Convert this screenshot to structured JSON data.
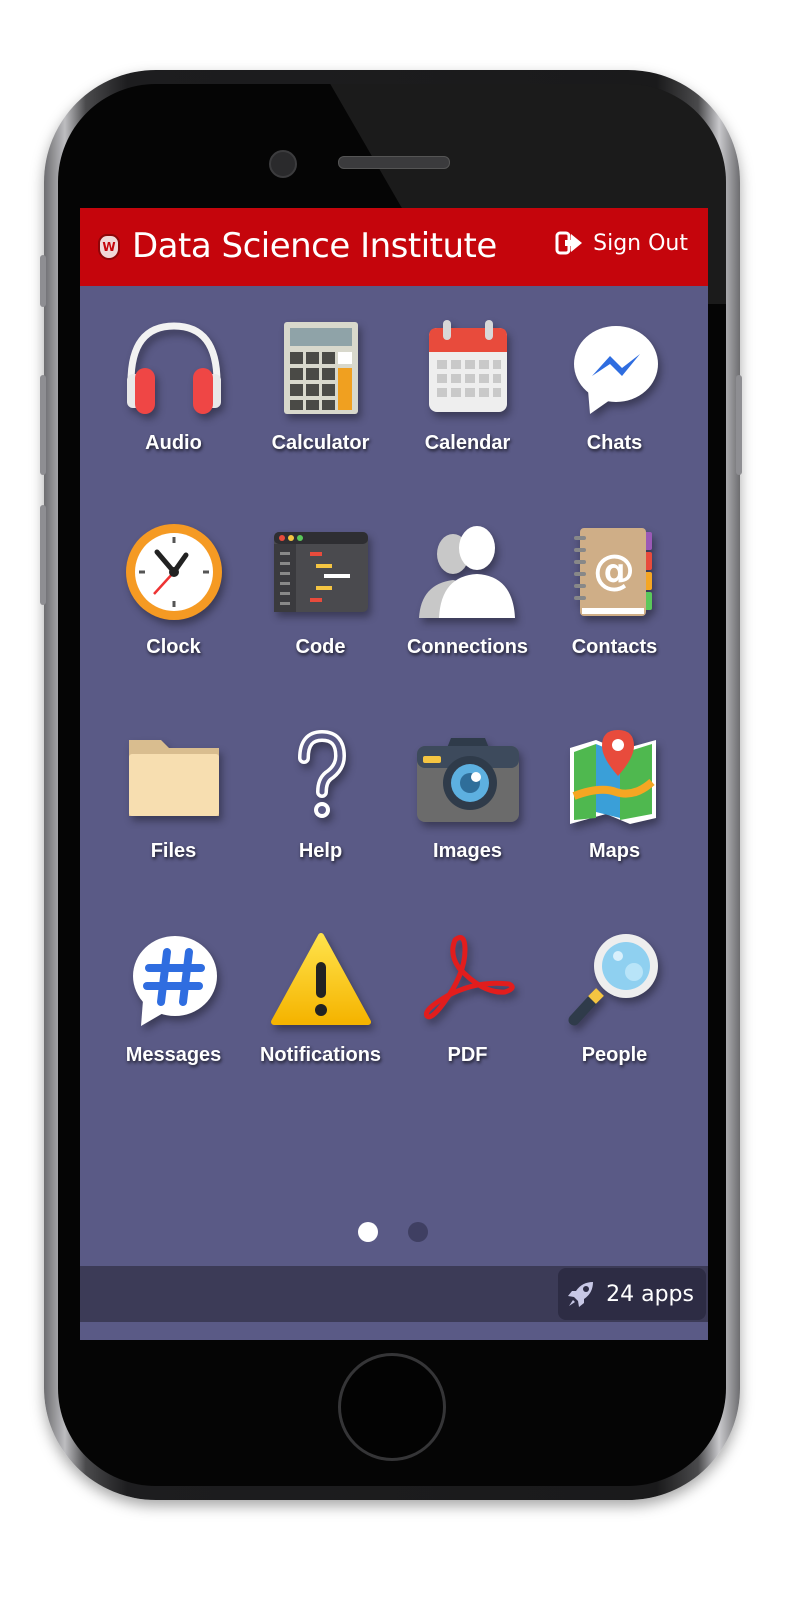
{
  "header": {
    "title": "Data Science Institute",
    "signout_label": "Sign Out",
    "colors": {
      "header_bg": "#c5050c",
      "screen_bg": "#5a5a86"
    }
  },
  "apps": [
    {
      "label": "Audio",
      "icon": "headphones-icon"
    },
    {
      "label": "Calculator",
      "icon": "calculator-icon"
    },
    {
      "label": "Calendar",
      "icon": "calendar-icon"
    },
    {
      "label": "Chats",
      "icon": "messenger-bubble-icon"
    },
    {
      "label": "Clock",
      "icon": "clock-icon"
    },
    {
      "label": "Code",
      "icon": "code-editor-icon"
    },
    {
      "label": "Connections",
      "icon": "people-silhouettes-icon"
    },
    {
      "label": "Contacts",
      "icon": "address-book-icon"
    },
    {
      "label": "Files",
      "icon": "folder-icon"
    },
    {
      "label": "Help",
      "icon": "question-mark-icon"
    },
    {
      "label": "Images",
      "icon": "camera-icon"
    },
    {
      "label": "Maps",
      "icon": "map-pin-icon"
    },
    {
      "label": "Messages",
      "icon": "hashtag-bubble-icon"
    },
    {
      "label": "Notifications",
      "icon": "warning-triangle-icon"
    },
    {
      "label": "PDF",
      "icon": "acrobat-icon"
    },
    {
      "label": "People",
      "icon": "magnifier-icon"
    }
  ],
  "pagination": {
    "pages": 2,
    "current": 1
  },
  "footer": {
    "app_count": "24 apps",
    "icon": "rocket-icon"
  }
}
